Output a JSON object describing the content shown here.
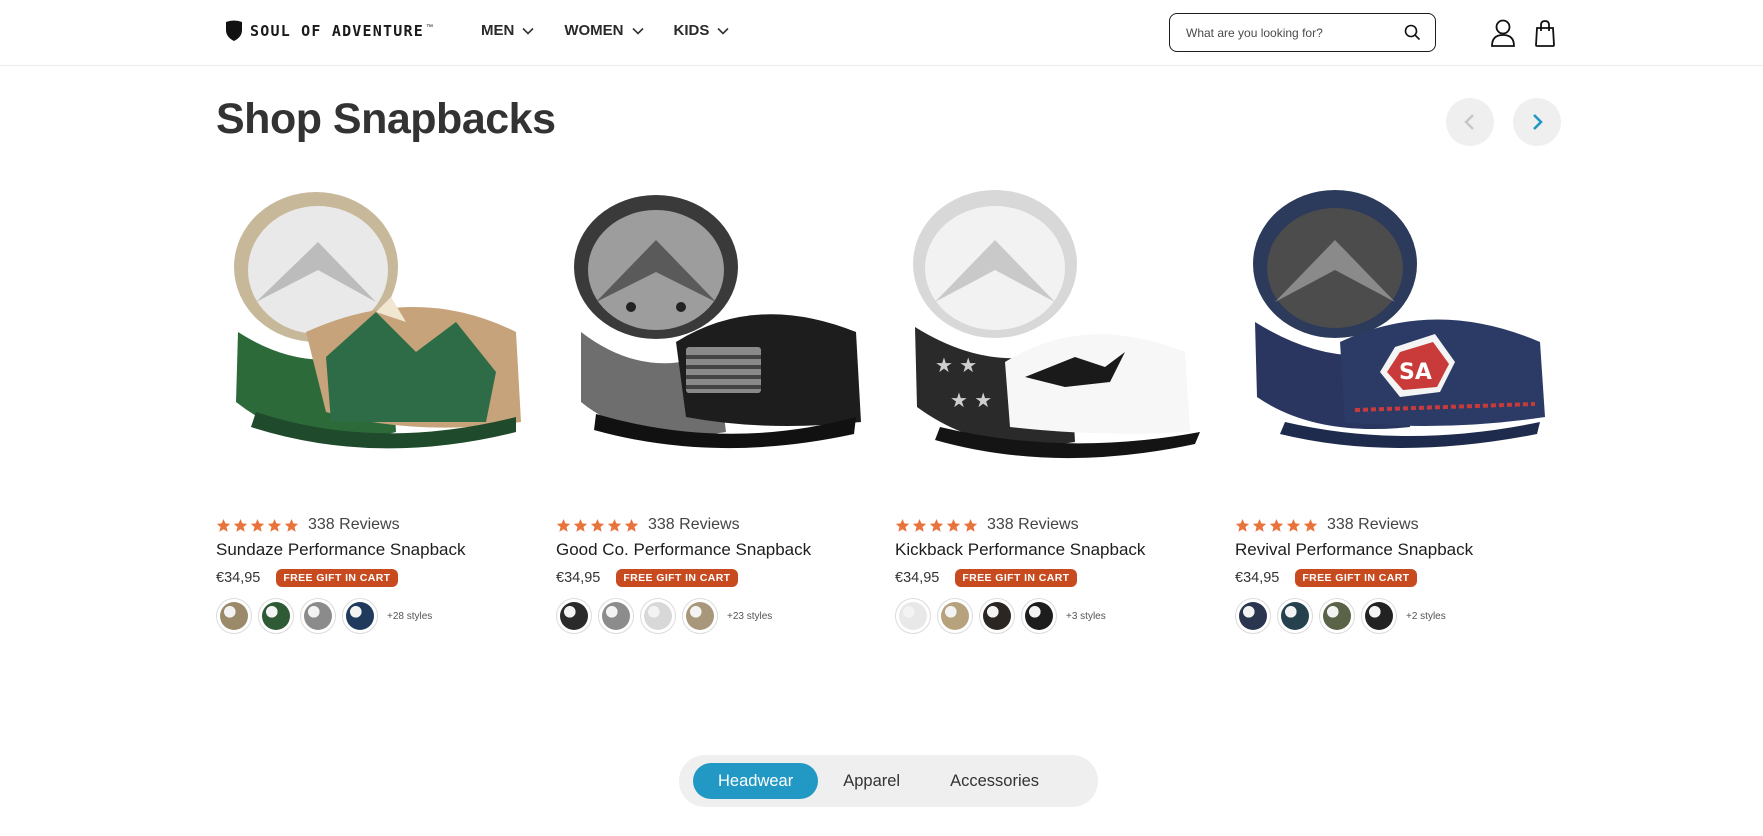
{
  "header": {
    "logo_text": "SOUL OF ADVENTURE",
    "logo_mark": "™",
    "nav": [
      {
        "label": "MEN"
      },
      {
        "label": "WOMEN"
      },
      {
        "label": "KIDS"
      }
    ],
    "search_placeholder": "What are you looking for?"
  },
  "section": {
    "title": "Shop Snapbacks"
  },
  "products": [
    {
      "reviews": "338 Reviews",
      "name": "Sundaze Performance Snapback",
      "price": "€34,95",
      "badge": "FREE GIFT IN CART",
      "more_styles": "+28 styles",
      "rating": 5,
      "swatch_colors": [
        "#9a8a6a",
        "#2e5a35",
        "#8b8b8b",
        "#1f3a5c"
      ]
    },
    {
      "reviews": "338 Reviews",
      "name": "Good Co. Performance Snapback",
      "price": "€34,95",
      "badge": "FREE GIFT IN CART",
      "more_styles": "+23 styles",
      "rating": 5,
      "swatch_colors": [
        "#2a2a2a",
        "#8c8c8c",
        "#d8d8d8",
        "#a8977a"
      ]
    },
    {
      "reviews": "338 Reviews",
      "name": "Kickback Performance Snapback",
      "price": "€34,95",
      "badge": "FREE GIFT IN CART",
      "more_styles": "+3 styles",
      "rating": 5,
      "swatch_colors": [
        "#e8e8e8",
        "#b7a27e",
        "#2b2622",
        "#1d1d1d"
      ]
    },
    {
      "reviews": "338 Reviews",
      "name": "Revival Performance Snapback",
      "price": "€34,95",
      "badge": "FREE GIFT IN CART",
      "more_styles": "+2 styles",
      "rating": 5,
      "swatch_colors": [
        "#2a3550",
        "#24414d",
        "#5a6248",
        "#222222"
      ]
    }
  ],
  "category_tabs": [
    {
      "label": "Headwear",
      "active": true
    },
    {
      "label": "Apparel",
      "active": false
    },
    {
      "label": "Accessories",
      "active": false
    }
  ],
  "colors": {
    "accent": "#2199c4",
    "star": "#e8743b",
    "badge": "#c84a1f"
  }
}
